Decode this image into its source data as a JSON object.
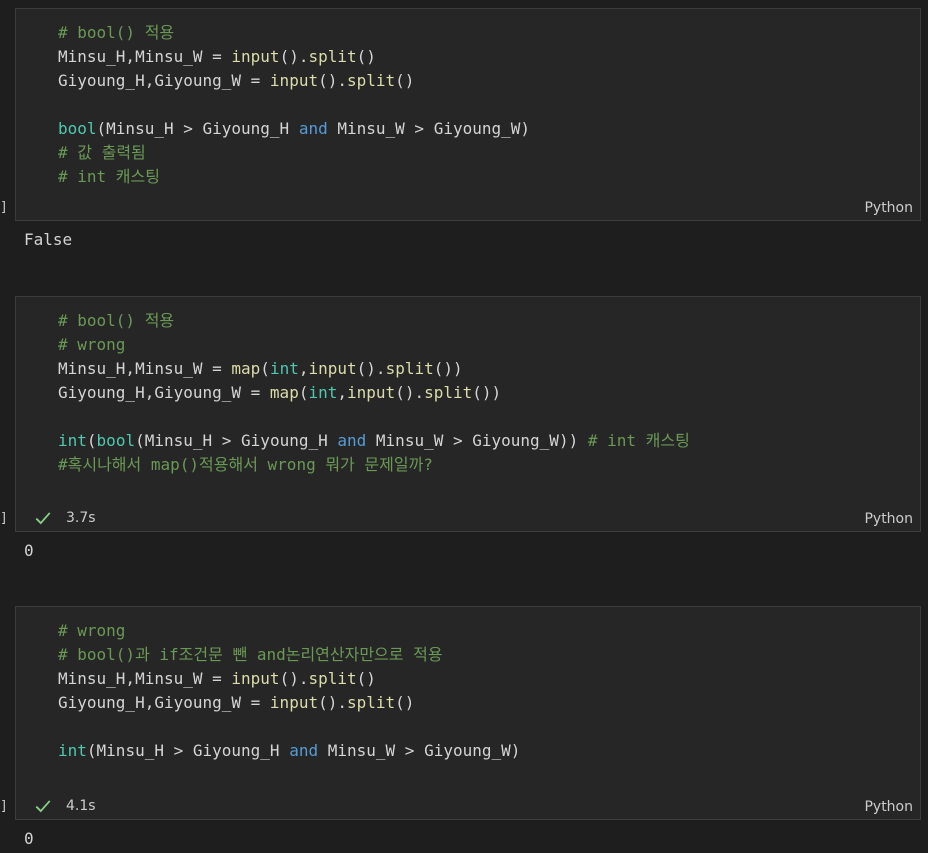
{
  "cells": [
    {
      "lines": [
        "# bool() 적용",
        "Minsu_H,Minsu_W = input().split()",
        "Giyoung_H,Giyoung_W = input().split()",
        "",
        "bool(Minsu_H > Giyoung_H and Minsu_W > Giyoung_W)",
        "# 값 출력됨",
        "# int 캐스팅"
      ],
      "language": "Python",
      "bracket": "]",
      "output": "False"
    },
    {
      "lines": [
        "# bool() 적용",
        "# wrong",
        "Minsu_H,Minsu_W = map(int,input().split())",
        "Giyoung_H,Giyoung_W = map(int,input().split())",
        "",
        "int(bool(Minsu_H > Giyoung_H and Minsu_W > Giyoung_W)) # int 캐스팅",
        "#혹시나해서 map()적용해서 wrong 뭐가 문제일까?"
      ],
      "status_time": "3.7s",
      "language": "Python",
      "bracket": "]",
      "output": "0"
    },
    {
      "lines": [
        "# wrong",
        "# bool()과 if조건문 뺀 and논리연산자만으로 적용",
        "Minsu_H,Minsu_W = input().split()",
        "Giyoung_H,Giyoung_W = input().split()",
        "",
        "int(Minsu_H > Giyoung_H and Minsu_W > Giyoung_W)"
      ],
      "status_time": "4.1s",
      "language": "Python",
      "bracket": "]",
      "output": "0"
    }
  ],
  "colors": {
    "comment": "#6a9955",
    "function": "#dcdcaa",
    "builtin_type": "#4ec9b0",
    "keyword": "#569cd6",
    "success_check": "#89d185"
  }
}
